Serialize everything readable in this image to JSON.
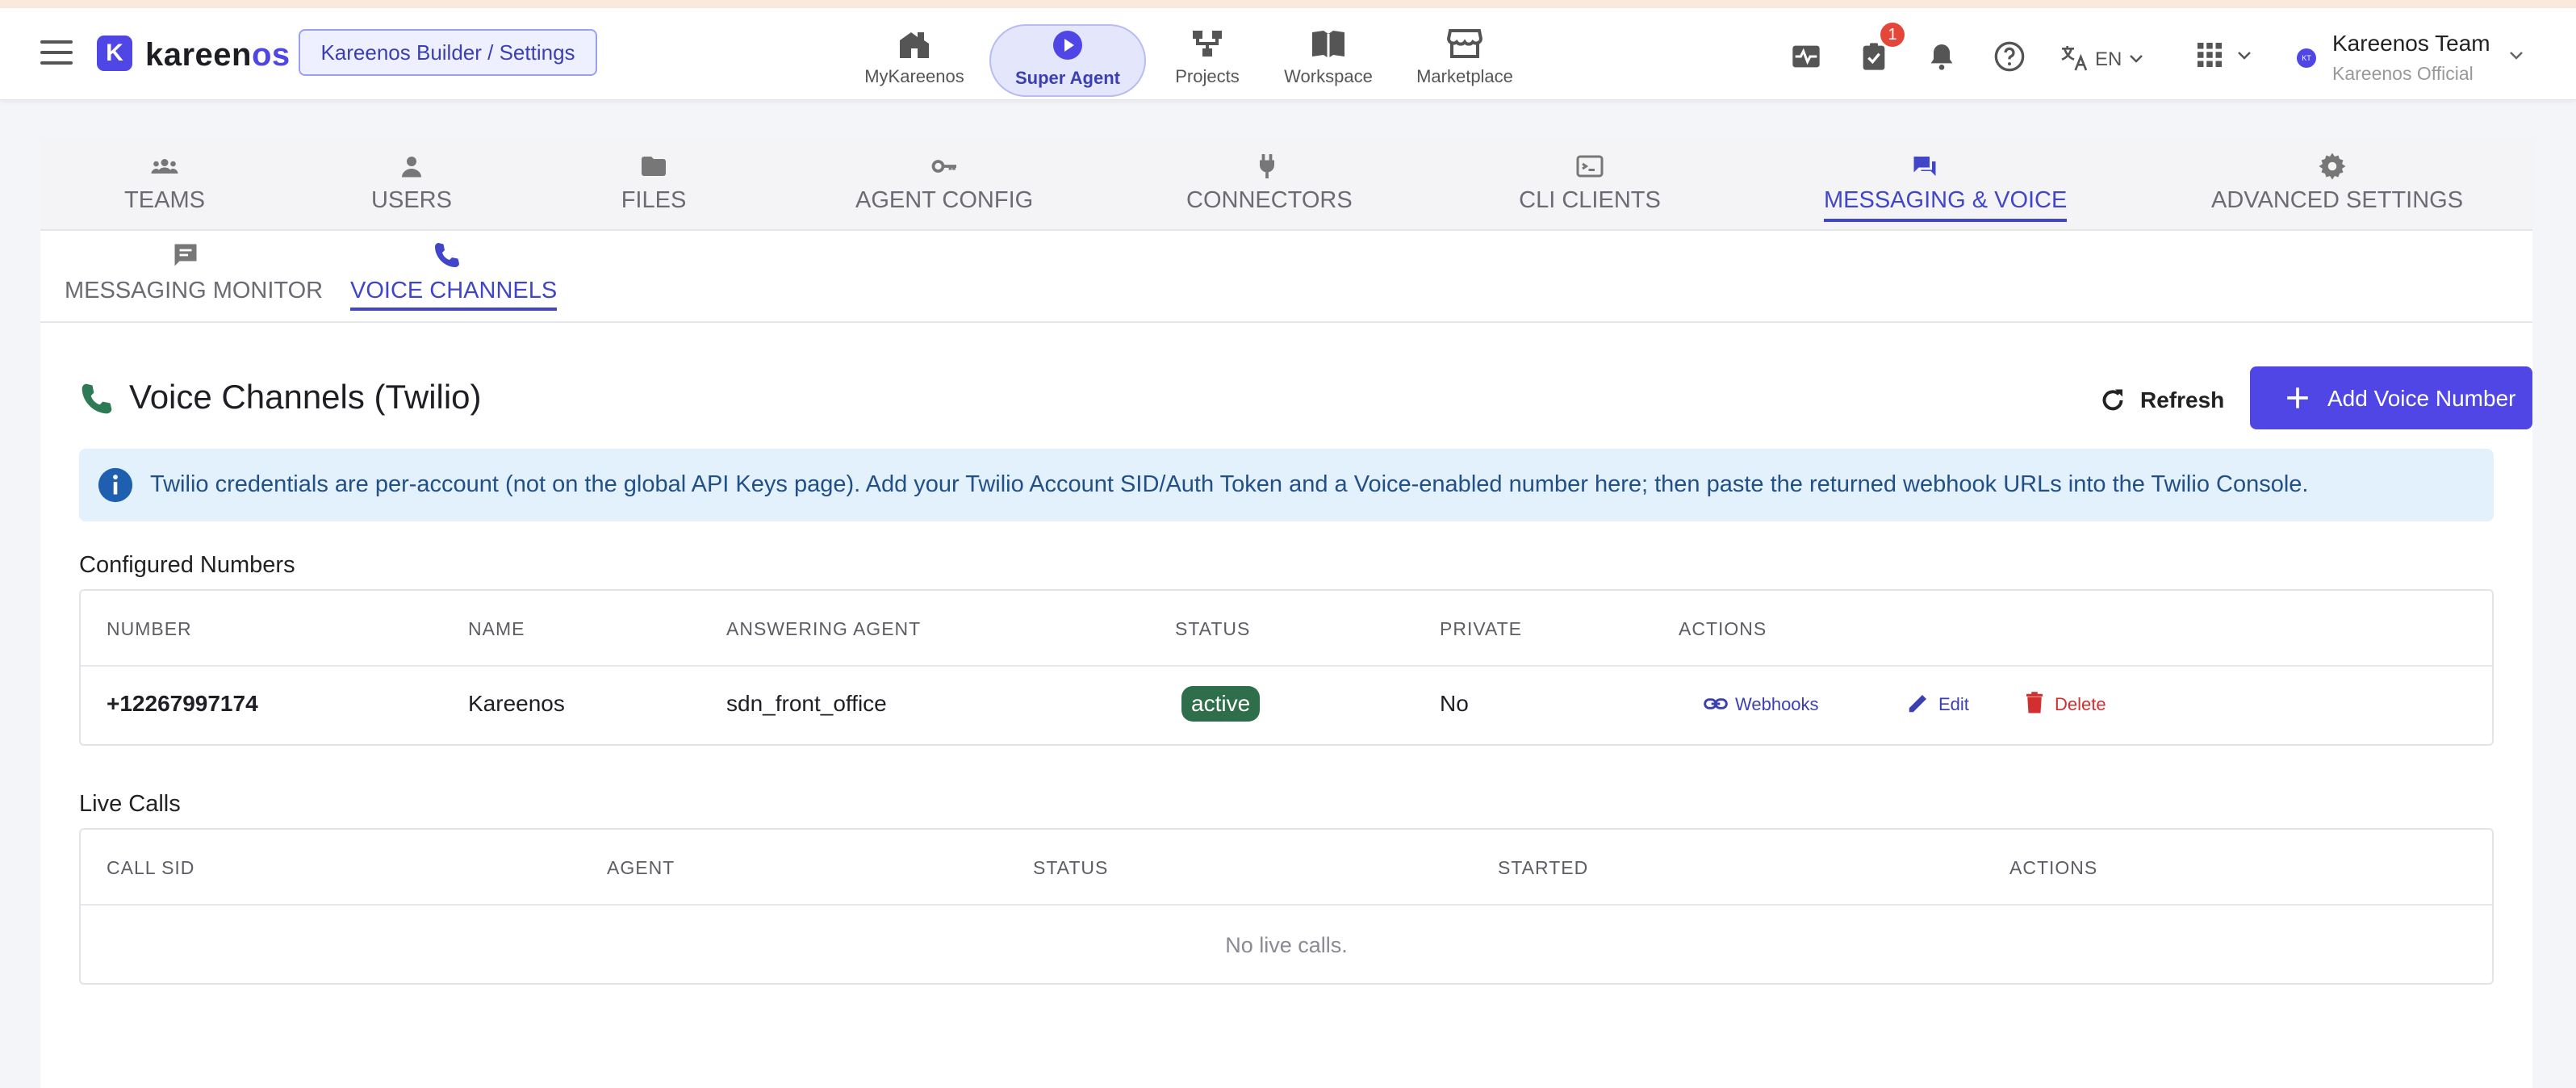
{
  "header": {
    "logo_letter": "K",
    "logo_main": "kareen",
    "logo_accent": "os",
    "breadcrumb": "Kareenos Builder / Settings",
    "nav": [
      {
        "label": "MyKareenos",
        "icon": "home-icon"
      },
      {
        "label": "Super Agent",
        "icon": "play-icon"
      },
      {
        "label": "Projects",
        "icon": "hierarchy-icon"
      },
      {
        "label": "Workspace",
        "icon": "book-icon"
      },
      {
        "label": "Marketplace",
        "icon": "store-icon"
      }
    ],
    "tasks_badge": "1",
    "language": "EN",
    "user": {
      "initials": "KT",
      "name": "Kareenos Team",
      "org": "Kareenos Official"
    }
  },
  "tabs": [
    {
      "label": "TEAMS",
      "icon": "group-icon"
    },
    {
      "label": "USERS",
      "icon": "person-icon"
    },
    {
      "label": "FILES",
      "icon": "folder-icon"
    },
    {
      "label": "AGENT CONFIG",
      "icon": "key-icon"
    },
    {
      "label": "CONNECTORS",
      "icon": "plug-icon"
    },
    {
      "label": "CLI CLIENTS",
      "icon": "terminal-icon"
    },
    {
      "label": "MESSAGING & VOICE",
      "icon": "chat-icon"
    },
    {
      "label": "ADVANCED SETTINGS",
      "icon": "gear-icon"
    }
  ],
  "active_tab": "MESSAGING & VOICE",
  "subtabs": [
    {
      "label": "MESSAGING MONITOR",
      "icon": "message-icon"
    },
    {
      "label": "VOICE CHANNELS",
      "icon": "phone-icon"
    }
  ],
  "active_subtab": "VOICE CHANNELS",
  "page": {
    "title": "Voice Channels (Twilio)",
    "refresh_label": "Refresh",
    "add_label": "Add Voice Number",
    "info": "Twilio credentials are per-account (not on the global API Keys page). Add your Twilio Account SID/Auth Token and a Voice-enabled number here; then paste the returned webhook URLs into the Twilio Console."
  },
  "configured": {
    "label": "Configured Numbers",
    "columns": [
      "NUMBER",
      "NAME",
      "ANSWERING AGENT",
      "STATUS",
      "PRIVATE",
      "ACTIONS"
    ],
    "rows": [
      {
        "number": "+12267997174",
        "name": "Kareenos",
        "agent": "sdn_front_office",
        "status": "active",
        "private": "No"
      }
    ],
    "actions": {
      "webhooks": "Webhooks",
      "edit": "Edit",
      "delete": "Delete"
    }
  },
  "live_calls": {
    "label": "Live Calls",
    "columns": [
      "CALL SID",
      "AGENT",
      "STATUS",
      "STARTED",
      "ACTIONS"
    ],
    "empty": "No live calls."
  },
  "colors": {
    "accent": "#4f46e5",
    "active_status": "#2f6e4a",
    "delete": "#d32f2f",
    "info_bg": "#e3f1fd"
  }
}
